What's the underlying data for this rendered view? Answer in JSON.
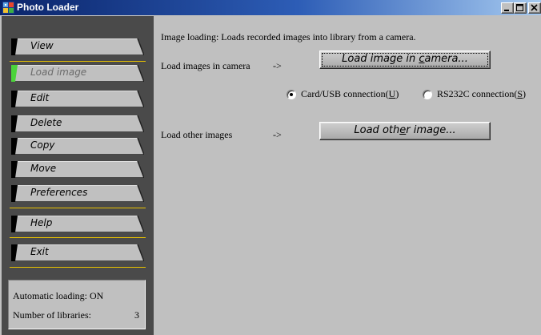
{
  "window": {
    "title": "Photo Loader",
    "icon": "photo-loader-app-icon",
    "controls": [
      "minimize",
      "maximize",
      "close"
    ]
  },
  "sidebar": {
    "items": [
      {
        "label": "View"
      },
      {
        "label": "Load image",
        "active": true
      },
      {
        "label": "Edit"
      },
      {
        "label": "Delete"
      },
      {
        "label": "Copy"
      },
      {
        "label": "Move"
      },
      {
        "label": "Preferences"
      },
      {
        "label": "Help"
      },
      {
        "label": "Exit"
      }
    ],
    "status": {
      "auto_loading": "Automatic loading: ON",
      "libraries_label": "Number of libraries:",
      "libraries_value": "3"
    }
  },
  "main": {
    "description": "Image loading: Loads recorded images into library from a camera.",
    "camera_row": {
      "label": "Load images in camera",
      "arrow": "->",
      "button_before": "Load image in ",
      "button_accel": "c",
      "button_after": "amera..."
    },
    "connection": {
      "option1_before": "Card/USB connection(",
      "option1_accel": "U",
      "option1_after": ")",
      "option2_before": "RS232C connection(",
      "option2_accel": "S",
      "option2_after": ")",
      "selected": 1
    },
    "other_row": {
      "label": "Load other images",
      "arrow": "->",
      "button_before": "Load oth",
      "button_accel": "e",
      "button_after": "r image..."
    }
  },
  "colors": {
    "sidebar_bg": "#4a4a4a",
    "separator": "#e8c200",
    "active_indicator": "#4bd43a",
    "window_bg": "#c0c0c0",
    "titlebar": "#0a246a"
  }
}
